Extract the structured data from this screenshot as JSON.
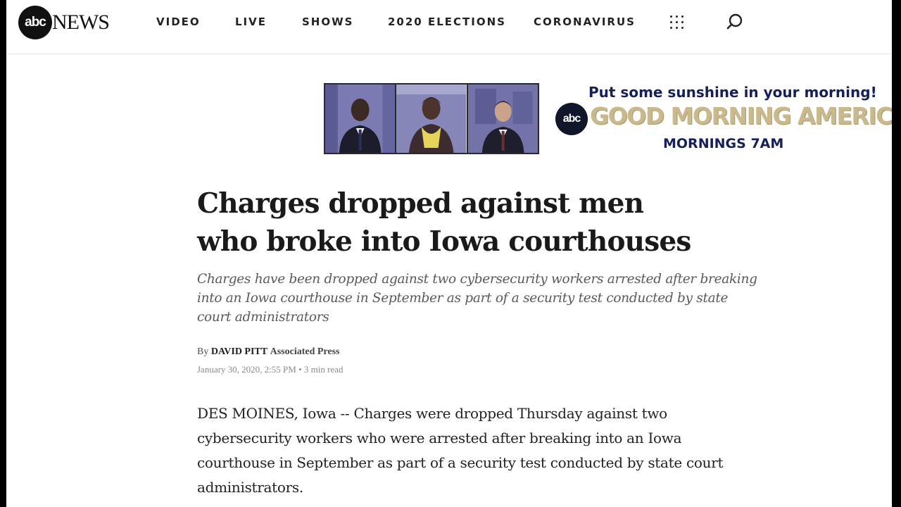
{
  "header": {
    "logo": {
      "mark": "abc",
      "word": "NEWS"
    },
    "nav": [
      "VIDEO",
      "LIVE",
      "SHOWS",
      "2020 ELECTIONS",
      "CORONAVIRUS"
    ],
    "icons": {
      "menu": "grid-menu-icon",
      "search": "search-icon"
    }
  },
  "ad": {
    "tagline": "Put some sunshine in your morning!",
    "logo_mark": "abc",
    "show": "GOOD MORNING AMERICA",
    "schedule": "MORNINGS 7AM",
    "colors": {
      "navy": "#15205a",
      "gold": "#c9b98c",
      "photo_tint": "#6f6fa8"
    }
  },
  "article": {
    "headline": "Charges dropped against men who broke into Iowa courthouses",
    "dek": "Charges have been dropped against two cybersecurity workers arrested after breaking into an Iowa courthouse in September as part of a security test conducted by state court administrators",
    "byline": {
      "by": "By",
      "author": "DAVID PITT",
      "source": "Associated Press"
    },
    "date": "January 30, 2020, 2:55 PM",
    "read_time": "3 min read",
    "body": "DES MOINES, Iowa -- Charges were dropped Thursday against two cybersecurity workers who were arrested after breaking into an Iowa courthouse in September as part of a security test conducted by state court administrators."
  }
}
